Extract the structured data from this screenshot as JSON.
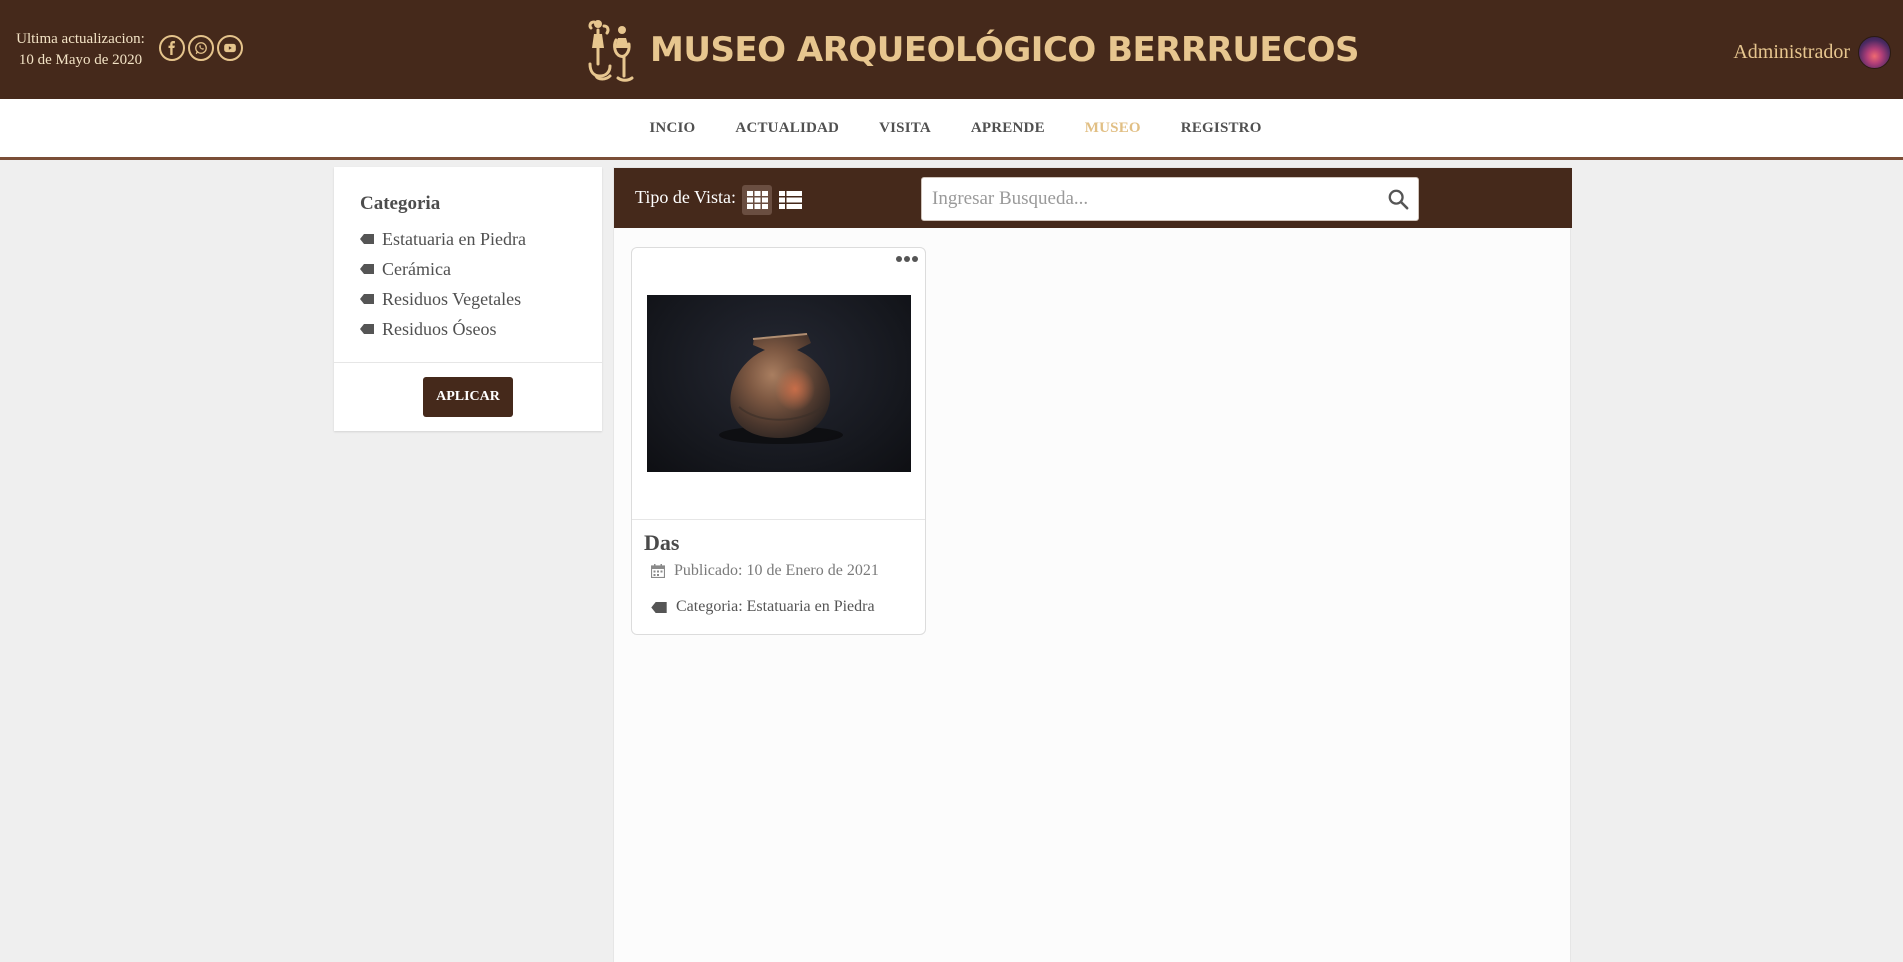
{
  "header": {
    "update_label": "Ultima actualizacion:",
    "update_date": "10 de Mayo de 2020",
    "title": "MUSEO ARQUEOLÓGICO BERRRUECOS",
    "user_name": "Administrador",
    "brand_color": "#45291b",
    "accent_color": "#e7c68f",
    "social_icons": [
      "facebook-icon",
      "whatsapp-icon",
      "youtube-icon"
    ]
  },
  "nav": {
    "items": [
      {
        "label": "INCIO",
        "active": false
      },
      {
        "label": "ACTUALIDAD",
        "active": false
      },
      {
        "label": "VISITA",
        "active": false
      },
      {
        "label": "APRENDE",
        "active": false
      },
      {
        "label": "MUSEO",
        "active": true
      },
      {
        "label": "REGISTRO",
        "active": false
      }
    ]
  },
  "sidebar": {
    "title": "Categoria",
    "categories": [
      "Estatuaria en Piedra",
      "Cerámica",
      "Residuos Vegetales",
      "Residuos Óseos"
    ],
    "apply_label": "APLICAR"
  },
  "toolbar": {
    "view_label": "Tipo de Vista:",
    "view_modes": [
      "grid-view-icon",
      "list-view-icon"
    ],
    "selected_view": "grid",
    "search_placeholder": "Ingresar Busqueda...",
    "search_value": ""
  },
  "items": [
    {
      "title": "Das",
      "published": "Publicado: 10 de Enero de 2021",
      "category": "Categoria: Estatuaria en Piedra"
    }
  ]
}
